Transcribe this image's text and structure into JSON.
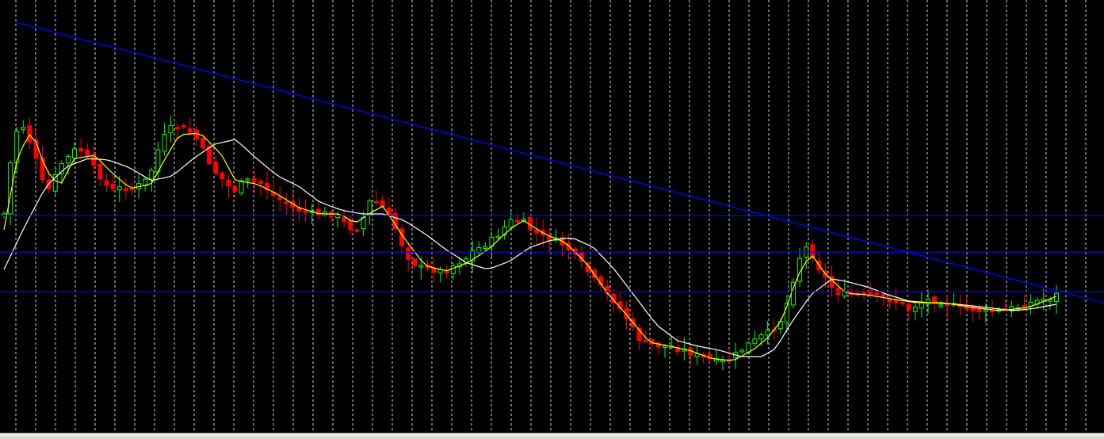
{
  "colors": {
    "background": "#000000",
    "grid": "#ffffff",
    "bull": "#00ff00",
    "bear": "#ff0000",
    "ma_fast": "#ffff00",
    "ma_slow": "#ffffff",
    "lines": "#0000ff"
  },
  "chart_data": {
    "type": "candlestick",
    "title": "",
    "xlabel": "",
    "ylabel": "",
    "grid": "vertical dotted",
    "legend": "none",
    "ylim": [
      0,
      546
    ],
    "candle_count": 165,
    "close_anchors": [
      [
        0,
        270
      ],
      [
        2,
        200
      ],
      [
        4,
        158
      ],
      [
        6,
        160
      ],
      [
        7,
        175
      ],
      [
        8,
        185
      ],
      [
        12,
        245
      ],
      [
        14,
        230
      ],
      [
        16,
        208
      ],
      [
        18,
        200
      ],
      [
        20,
        190
      ],
      [
        22,
        190
      ],
      [
        24,
        200
      ],
      [
        26,
        215
      ],
      [
        28,
        225
      ],
      [
        30,
        240
      ],
      [
        32,
        240
      ],
      [
        34,
        235
      ],
      [
        36,
        240
      ],
      [
        38,
        235
      ],
      [
        40,
        230
      ],
      [
        42,
        215
      ],
      [
        44,
        188
      ],
      [
        46,
        170
      ],
      [
        48,
        160
      ],
      [
        50,
        160
      ],
      [
        52,
        165
      ],
      [
        54,
        168
      ],
      [
        56,
        185
      ],
      [
        58,
        200
      ],
      [
        60,
        216
      ],
      [
        62,
        225
      ],
      [
        64,
        235
      ],
      [
        66,
        240
      ],
      [
        68,
        230
      ],
      [
        70,
        228
      ],
      [
        72,
        230
      ],
      [
        74,
        232
      ],
      [
        76,
        245
      ],
      [
        78,
        250
      ],
      [
        80,
        255
      ],
      [
        82,
        262
      ],
      [
        84,
        265
      ],
      [
        86,
        268
      ],
      [
        88,
        270
      ],
      [
        90,
        270
      ],
      [
        92,
        270
      ],
      [
        94,
        270
      ],
      [
        96,
        278
      ],
      [
        98,
        285
      ],
      [
        100,
        290
      ],
      [
        102,
        280
      ],
      [
        104,
        255
      ],
      [
        106,
        255
      ],
      [
        108,
        262
      ],
      [
        110,
        275
      ],
      [
        112,
        292
      ],
      [
        114,
        315
      ],
      [
        116,
        330
      ],
      [
        118,
        336
      ],
      [
        120,
        340
      ],
      [
        122,
        340
      ],
      [
        124,
        342
      ],
      [
        126,
        342
      ],
      [
        128,
        335
      ],
      [
        130,
        330
      ],
      [
        132,
        325
      ],
      [
        134,
        315
      ],
      [
        136,
        312
      ],
      [
        138,
        306
      ],
      [
        140,
        300
      ],
      [
        142,
        290
      ],
      [
        144,
        280
      ],
      [
        146,
        277
      ],
      [
        148,
        280
      ],
      [
        150,
        288
      ],
      [
        152,
        295
      ],
      [
        154,
        300
      ],
      [
        156,
        302
      ],
      [
        158,
        305
      ],
      [
        160,
        310
      ],
      [
        162,
        320
      ],
      [
        164,
        330
      ],
      [
        166,
        340
      ],
      [
        168,
        352
      ],
      [
        170,
        362
      ],
      [
        172,
        372
      ],
      [
        174,
        380
      ],
      [
        176,
        392
      ],
      [
        178,
        405
      ],
      [
        180,
        422
      ],
      [
        182,
        432
      ],
      [
        184,
        434
      ],
      [
        186,
        436
      ],
      [
        188,
        437
      ],
      [
        190,
        437
      ],
      [
        192,
        440
      ],
      [
        194,
        442
      ],
      [
        196,
        446
      ],
      [
        198,
        450
      ],
      [
        200,
        452
      ],
      [
        202,
        455
      ],
      [
        204,
        458
      ],
      [
        206,
        455
      ],
      [
        208,
        450
      ],
      [
        210,
        442
      ],
      [
        212,
        435
      ],
      [
        214,
        430
      ],
      [
        216,
        424
      ],
      [
        218,
        420
      ],
      [
        220,
        412
      ],
      [
        222,
        400
      ],
      [
        224,
        370
      ],
      [
        226,
        335
      ],
      [
        228,
        310
      ],
      [
        230,
        318
      ],
      [
        232,
        336
      ],
      [
        234,
        350
      ],
      [
        236,
        362
      ],
      [
        238,
        370
      ],
      [
        240,
        372
      ],
      [
        242,
        372
      ],
      [
        244,
        372
      ],
      [
        246,
        372
      ],
      [
        248,
        374
      ],
      [
        250,
        376
      ],
      [
        252,
        378
      ],
      [
        254,
        380
      ],
      [
        256,
        385
      ],
      [
        258,
        390
      ],
      [
        260,
        385
      ],
      [
        262,
        380
      ],
      [
        264,
        378
      ],
      [
        266,
        380
      ],
      [
        268,
        382
      ],
      [
        270,
        385
      ],
      [
        272,
        388
      ],
      [
        274,
        390
      ],
      [
        276,
        390
      ],
      [
        278,
        392
      ],
      [
        280,
        394
      ],
      [
        282,
        393
      ],
      [
        284,
        392
      ],
      [
        286,
        390
      ],
      [
        288,
        388
      ],
      [
        290,
        386
      ],
      [
        292,
        383
      ],
      [
        294,
        380
      ],
      [
        296,
        378
      ],
      [
        298,
        376
      ],
      [
        300,
        372
      ]
    ],
    "ma_fast_anchors": [
      [
        0,
        290
      ],
      [
        4,
        195
      ],
      [
        8,
        165
      ],
      [
        12,
        215
      ],
      [
        16,
        235
      ],
      [
        20,
        200
      ],
      [
        26,
        196
      ],
      [
        30,
        215
      ],
      [
        36,
        238
      ],
      [
        42,
        232
      ],
      [
        46,
        200
      ],
      [
        50,
        170
      ],
      [
        56,
        168
      ],
      [
        62,
        195
      ],
      [
        66,
        228
      ],
      [
        72,
        232
      ],
      [
        78,
        245
      ],
      [
        84,
        262
      ],
      [
        90,
        270
      ],
      [
        96,
        270
      ],
      [
        100,
        282
      ],
      [
        104,
        270
      ],
      [
        108,
        260
      ],
      [
        114,
        300
      ],
      [
        120,
        335
      ],
      [
        126,
        342
      ],
      [
        132,
        332
      ],
      [
        138,
        315
      ],
      [
        144,
        290
      ],
      [
        148,
        278
      ],
      [
        154,
        295
      ],
      [
        160,
        306
      ],
      [
        166,
        332
      ],
      [
        172,
        370
      ],
      [
        178,
        400
      ],
      [
        184,
        432
      ],
      [
        190,
        437
      ],
      [
        196,
        443
      ],
      [
        202,
        453
      ],
      [
        208,
        455
      ],
      [
        214,
        440
      ],
      [
        218,
        425
      ],
      [
        222,
        402
      ],
      [
        226,
        350
      ],
      [
        230,
        320
      ],
      [
        234,
        345
      ],
      [
        240,
        370
      ],
      [
        246,
        372
      ],
      [
        254,
        378
      ],
      [
        260,
        382
      ],
      [
        268,
        382
      ],
      [
        276,
        388
      ],
      [
        284,
        392
      ],
      [
        292,
        388
      ],
      [
        300,
        374
      ]
    ],
    "ma_slow_anchors": [
      [
        0,
        340
      ],
      [
        6,
        285
      ],
      [
        12,
        235
      ],
      [
        18,
        210
      ],
      [
        24,
        200
      ],
      [
        30,
        202
      ],
      [
        36,
        212
      ],
      [
        42,
        228
      ],
      [
        48,
        222
      ],
      [
        54,
        200
      ],
      [
        60,
        182
      ],
      [
        66,
        176
      ],
      [
        72,
        200
      ],
      [
        78,
        222
      ],
      [
        84,
        235
      ],
      [
        90,
        255
      ],
      [
        96,
        265
      ],
      [
        102,
        270
      ],
      [
        108,
        270
      ],
      [
        114,
        278
      ],
      [
        120,
        295
      ],
      [
        126,
        315
      ],
      [
        132,
        332
      ],
      [
        138,
        340
      ],
      [
        144,
        330
      ],
      [
        150,
        312
      ],
      [
        156,
        303
      ],
      [
        162,
        300
      ],
      [
        168,
        312
      ],
      [
        174,
        340
      ],
      [
        180,
        375
      ],
      [
        186,
        410
      ],
      [
        192,
        430
      ],
      [
        198,
        437
      ],
      [
        204,
        442
      ],
      [
        210,
        450
      ],
      [
        216,
        450
      ],
      [
        220,
        440
      ],
      [
        224,
        410
      ],
      [
        230,
        372
      ],
      [
        236,
        352
      ],
      [
        240,
        355
      ],
      [
        246,
        362
      ],
      [
        252,
        372
      ],
      [
        258,
        380
      ],
      [
        264,
        382
      ],
      [
        272,
        384
      ],
      [
        280,
        388
      ],
      [
        288,
        392
      ],
      [
        294,
        389
      ],
      [
        300,
        384
      ]
    ],
    "descending_trendline": {
      "from": [
        4,
        28
      ],
      "to": [
        316,
        382
      ]
    },
    "horizontal_levels": [
      272,
      318,
      368
    ]
  }
}
